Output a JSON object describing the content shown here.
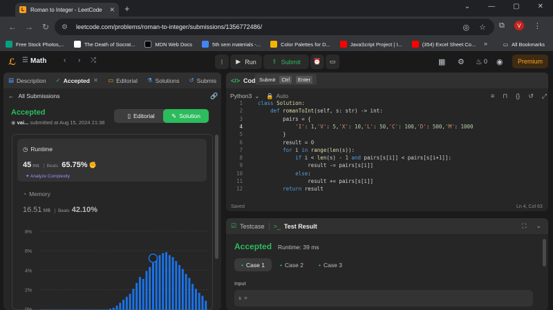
{
  "browser": {
    "tab_title": "Roman to Integer - LeetCode",
    "url": "leetcode.com/problems/roman-to-integer/submissions/1356772486/",
    "avatar_letter": "V",
    "bookmarks": [
      {
        "label": "Free Stock Photos,...",
        "color": "#05a081"
      },
      {
        "label": "The Death of Socrat...",
        "color": "#ffffff"
      },
      {
        "label": "MDN Web Docs",
        "color": "#000000"
      },
      {
        "label": "5th sem materials -...",
        "color": "#4285f4"
      },
      {
        "label": "Color Palettes for D...",
        "color": "#f4b400"
      },
      {
        "label": "JavaScript Project | I...",
        "color": "#ff0000"
      },
      {
        "label": "(354) Excel Sheet Co...",
        "color": "#ff0000"
      }
    ],
    "all_bookmarks": "All Bookmarks"
  },
  "header": {
    "problem_list": "Math",
    "run": "Run",
    "submit": "Submit",
    "fire_count": "0",
    "premium": "Premium",
    "tooltip": {
      "label": "Submit",
      "key1": "Ctrl",
      "key2": "Enter"
    }
  },
  "left": {
    "tabs": [
      "Description",
      "Accepted",
      "Editorial",
      "Solutions",
      "Submis"
    ],
    "all_submissions": "All Submissions",
    "status": "Accepted",
    "user": "vai...",
    "submitted_at": "submitted at Aug 15, 2024 21:38",
    "editorial_btn": "Editorial",
    "solution_btn": "Solution",
    "runtime": {
      "label": "Runtime",
      "value": "45",
      "unit": "ms",
      "beats_label": "Beats",
      "beats": "65.75%",
      "analyze": "Analyze Complexity"
    },
    "memory": {
      "label": "Memory",
      "value": "16.51",
      "unit": "MB",
      "beats_label": "Beats",
      "beats": "42.10%"
    }
  },
  "chart_data": {
    "type": "bar",
    "yticks": [
      "8%",
      "6%",
      "4%",
      "2%",
      "0%"
    ],
    "ylim": [
      0,
      8
    ],
    "values": [
      0.1,
      0.1,
      0.1,
      0.1,
      0.1,
      0.1,
      0.1,
      0.1,
      0.1,
      0.1,
      0.1,
      0.1,
      0.1,
      0.1,
      0.1,
      0.1,
      0.1,
      0.1,
      0.1,
      0.1,
      0.1,
      0.2,
      0.3,
      0.5,
      0.8,
      1.1,
      1.4,
      1.7,
      2.2,
      2.8,
      3.4,
      3.2,
      4.0,
      4.4,
      4.8,
      5.2,
      5.6,
      5.8,
      5.9,
      5.6,
      5.4,
      5.0,
      4.6,
      4.2,
      3.7,
      3.3,
      2.7,
      2.2,
      1.8,
      1.5,
      1.0
    ],
    "highlight_index": 34
  },
  "editor": {
    "title": "Code",
    "language": "Python3",
    "auto": "Auto",
    "lines": [
      "class Solution:",
      "    def romanToInt(self, s: str) -> int:",
      "        pairs = {",
      "            'I': 1,'V': 5,'X': 10,'L': 50,'C': 100,'D': 500,'M': 1000",
      "        }",
      "        result = 0",
      "        for i in range(len(s)):",
      "            if i < len(s) - 1 and pairs[s[i]] < pairs[s[i+1]]:",
      "                result -= pairs[s[i]]",
      "            else:",
      "                result += pairs[s[i]]",
      "        return result"
    ],
    "line_numbers": [
      "1",
      "2",
      "3",
      "4",
      "5",
      "6",
      "7",
      "8",
      "9",
      "10",
      "11",
      "12"
    ],
    "current_line": 4,
    "saved": "Saved",
    "cursor": "Ln 4, Col 63"
  },
  "result": {
    "tab_testcase": "Testcase",
    "tab_result": "Test Result",
    "status": "Accepted",
    "runtime": "Runtime: 39 ms",
    "cases": [
      "Case 1",
      "Case 2",
      "Case 3"
    ],
    "input_label": "Input",
    "input_value": "s ="
  }
}
